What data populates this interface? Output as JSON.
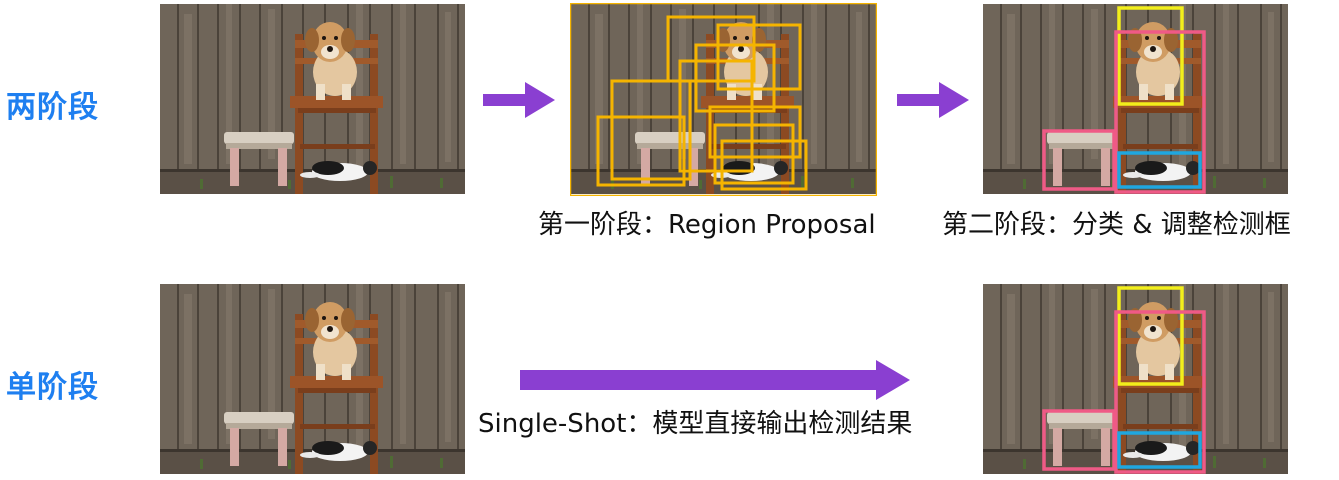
{
  "rows": {
    "two_stage": {
      "label": "两阶段"
    },
    "one_stage": {
      "label": "单阶段"
    }
  },
  "captions": {
    "stage1": "第一阶段：Region Proposal",
    "stage2": "第二阶段：分类 & 调整检测框",
    "single_shot": "Single-Shot：模型直接输出检测结果"
  },
  "colors": {
    "label_blue": "#1e7ff0",
    "arrow_purple": "#8a3fd1",
    "proposal_box": "#f5b400",
    "dog_box": "#f2ee1b",
    "chair_box": "#ef5a86",
    "stool_box": "#ef5a86",
    "cat_box": "#1fa7e0"
  },
  "photos": {
    "subject": [
      "dog",
      "chair",
      "stool",
      "cat"
    ]
  }
}
